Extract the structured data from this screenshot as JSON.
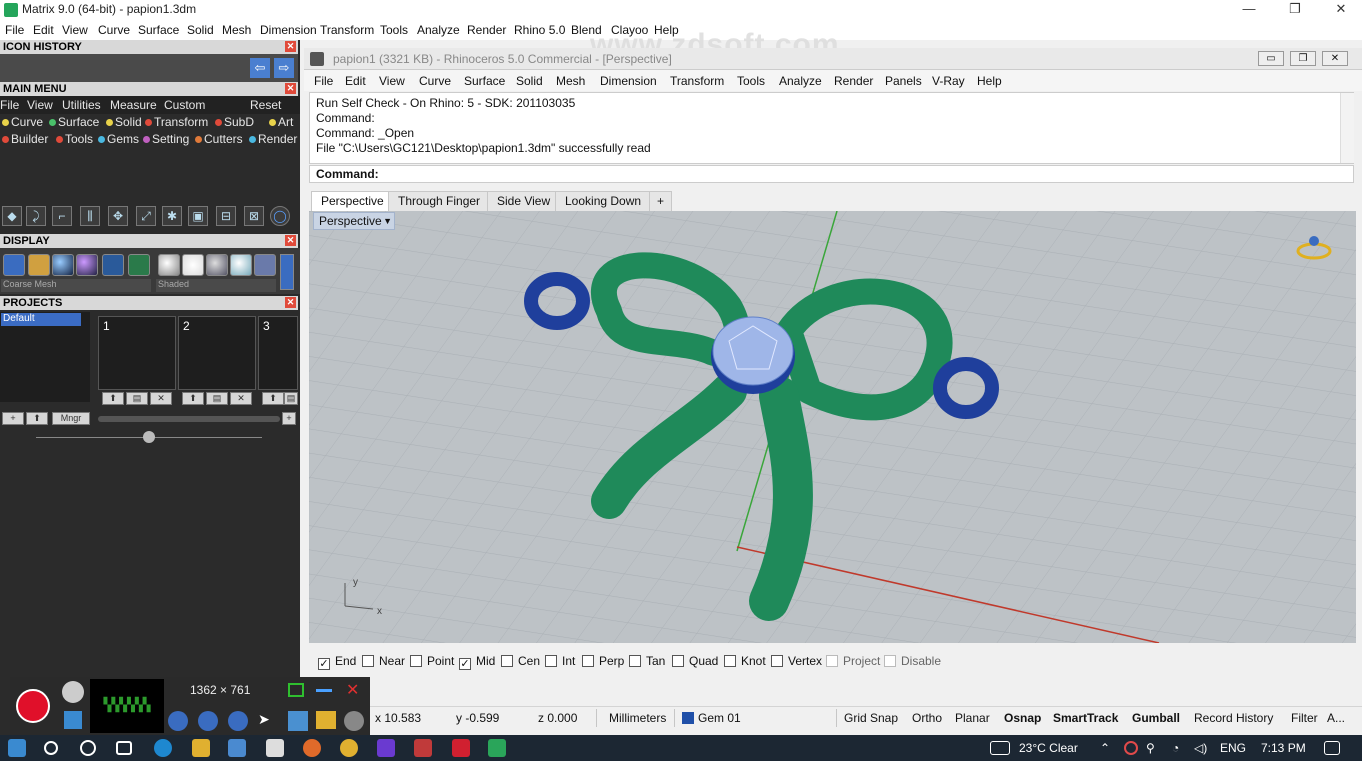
{
  "window": {
    "title": "Matrix 9.0 (64-bit) - papion1.3dm",
    "controls": [
      "—",
      "❐",
      "✕"
    ]
  },
  "menubar": [
    "File",
    "Edit",
    "View",
    "Curve",
    "Surface",
    "Solid",
    "Mesh",
    "Dimension",
    "Transform",
    "Tools",
    "Analyze",
    "Render",
    "Rhino 5.0",
    "Blend",
    "Clayoo",
    "Help"
  ],
  "watermark": "www.zdsoft.com",
  "left_panel": {
    "icon_history": "ICON HISTORY",
    "main_menu": "MAIN MENU",
    "main_menu_items": [
      "File",
      "View",
      "Utilities",
      "Measure",
      "Custom",
      "Reset"
    ],
    "categories_row1": [
      {
        "label": "Curve",
        "color": "#e8d24a"
      },
      {
        "label": "Surface",
        "color": "#4ac06a"
      },
      {
        "label": "Solid",
        "color": "#e8d24a"
      },
      {
        "label": "Transform",
        "color": "#e04a3a"
      },
      {
        "label": "SubD",
        "color": "#e04a3a"
      },
      {
        "label": "Art",
        "color": "#e8d24a"
      }
    ],
    "categories_row2": [
      {
        "label": "Builder",
        "color": "#e04a3a"
      },
      {
        "label": "Tools",
        "color": "#e04a3a"
      },
      {
        "label": "Gems",
        "color": "#4ab8e0"
      },
      {
        "label": "Setting",
        "color": "#c060c0"
      },
      {
        "label": "Cutters",
        "color": "#e07a3a"
      },
      {
        "label": "Render",
        "color": "#4ab8e0"
      }
    ],
    "display": "DISPLAY",
    "display_mesh": "Coarse Mesh",
    "display_mode": "Shaded",
    "projects": "PROJECTS",
    "project_default": "Default",
    "project_slots": [
      "1",
      "2",
      "3"
    ],
    "mngr": "Mngr"
  },
  "rhino": {
    "title": "papion1 (3321 KB) - Rhinoceros 5.0 Commercial - [Perspective]",
    "menu": [
      "File",
      "Edit",
      "View",
      "Curve",
      "Surface",
      "Solid",
      "Mesh",
      "Dimension",
      "Transform",
      "Tools",
      "Analyze",
      "Render",
      "Panels",
      "V-Ray",
      "Help"
    ],
    "history": [
      "Run Self Check - On Rhino: 5 - SDK: 201103035",
      "Command:",
      "Command: _Open",
      "File \"C:\\Users\\GC121\\Desktop\\papion1.3dm\" successfully read"
    ],
    "command_prompt": "Command:",
    "viewport_tabs": [
      "Perspective",
      "Through Finger",
      "Side View",
      "Looking Down"
    ],
    "add_tab": "+",
    "viewport_label": "Perspective",
    "axis_x": "x",
    "axis_y": "y"
  },
  "osnap": [
    {
      "label": "End",
      "checked": true
    },
    {
      "label": "Near",
      "checked": false
    },
    {
      "label": "Point",
      "checked": false
    },
    {
      "label": "Mid",
      "checked": true
    },
    {
      "label": "Cen",
      "checked": false
    },
    {
      "label": "Int",
      "checked": false
    },
    {
      "label": "Perp",
      "checked": false
    },
    {
      "label": "Tan",
      "checked": false
    },
    {
      "label": "Quad",
      "checked": false
    },
    {
      "label": "Knot",
      "checked": false
    },
    {
      "label": "Vertex",
      "checked": false
    },
    {
      "label": "Project",
      "checked": false
    },
    {
      "label": "Disable",
      "checked": false
    }
  ],
  "status": {
    "x": "x 10.583",
    "y": "y -0.599",
    "z": "z 0.000",
    "units": "Millimeters",
    "layer": "Gem 01",
    "layer_color": "#1f4fa8",
    "toggles": [
      {
        "label": "Grid Snap",
        "bold": false
      },
      {
        "label": "Ortho",
        "bold": false
      },
      {
        "label": "Planar",
        "bold": false
      },
      {
        "label": "Osnap",
        "bold": true
      },
      {
        "label": "SmartTrack",
        "bold": true
      },
      {
        "label": "Gumball",
        "bold": true
      },
      {
        "label": "Record History",
        "bold": false
      },
      {
        "label": "Filter",
        "bold": false
      },
      {
        "label": "A...",
        "bold": false
      }
    ]
  },
  "recorder": {
    "resolution": "1362 × 761"
  },
  "taskbar": {
    "weather": "23°C  Clear",
    "language": "ENG",
    "time": "7:13 PM"
  },
  "colors": {
    "bow_green": "#1f8a5a",
    "gem_blue": "#9fb6e8",
    "ring_blue": "#1f3f9c",
    "viewport_bg": "#bdc2c6"
  }
}
